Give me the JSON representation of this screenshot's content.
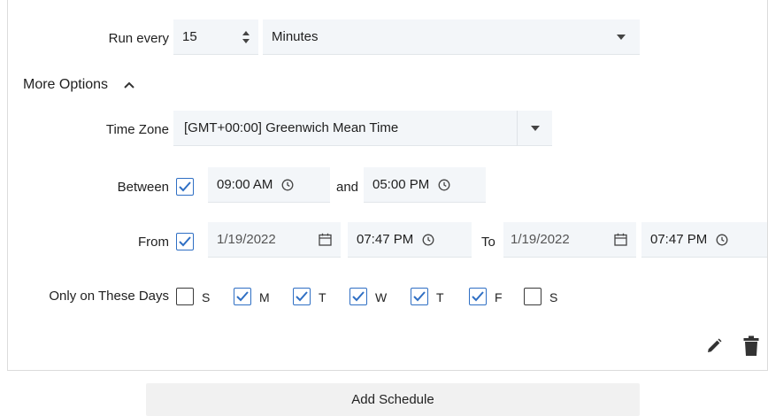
{
  "schedule": {
    "run_every": {
      "label": "Run every",
      "value": "15",
      "unit": "Minutes"
    },
    "more_options": {
      "label": "More Options"
    },
    "time_zone": {
      "label": "Time Zone",
      "value": "[GMT+00:00] Greenwich Mean Time"
    },
    "between": {
      "label": "Between",
      "checked": true,
      "start": "09:00 AM",
      "joiner": "and",
      "end": "05:00 PM"
    },
    "from": {
      "label": "From",
      "checked": true,
      "start_date": "1/19/2022",
      "start_time": "07:47 PM",
      "to_label": "To",
      "end_date": "1/19/2022",
      "end_time": "07:47 PM"
    },
    "days": {
      "label": "Only on These Days",
      "items": [
        {
          "letter": "S",
          "checked": false
        },
        {
          "letter": "M",
          "checked": true
        },
        {
          "letter": "T",
          "checked": true
        },
        {
          "letter": "W",
          "checked": true
        },
        {
          "letter": "T",
          "checked": true
        },
        {
          "letter": "F",
          "checked": true
        },
        {
          "letter": "S",
          "checked": false
        }
      ]
    },
    "add_button": "Add Schedule"
  },
  "colors": {
    "checkbox_checked": "#2f6fc4",
    "field_bg": "#f3f6f9",
    "button_bg": "#f1f1f1"
  },
  "icons": [
    "stepper-icon",
    "dropdown-icon",
    "chevron-up-icon",
    "clock-icon",
    "calendar-icon",
    "edit-icon",
    "trash-icon",
    "checkmark-icon"
  ]
}
